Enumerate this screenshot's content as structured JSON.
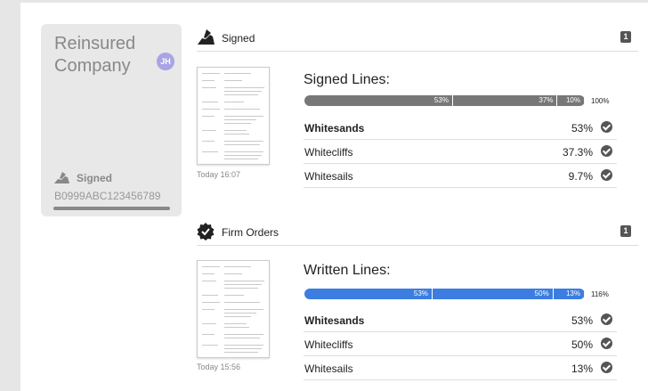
{
  "card": {
    "title": "Reinsured Company",
    "avatar_initials": "JH",
    "status": "Signed",
    "reference": "B0999ABC123456789"
  },
  "sections": [
    {
      "title": "Signed",
      "icon": "signing-hand-icon",
      "count": "1",
      "timestamp": "Today 16:07",
      "lines_title": "Signed Lines:",
      "bar_color": "#777777",
      "bar_segments": [
        {
          "label": "53%",
          "value": 53
        },
        {
          "label": "37%",
          "value": 37.3
        },
        {
          "label": "10%",
          "value": 9.7
        }
      ],
      "bar_total": "100%",
      "rows": [
        {
          "name": "Whitesands",
          "pct": "53%"
        },
        {
          "name": "Whitecliffs",
          "pct": "37.3%"
        },
        {
          "name": "Whitesails",
          "pct": "9.7%"
        }
      ]
    },
    {
      "title": "Firm Orders",
      "icon": "badge-check-icon",
      "count": "1",
      "timestamp": "Today 15:56",
      "lines_title": "Written Lines:",
      "bar_color": "#3b7de0",
      "bar_segments": [
        {
          "label": "53%",
          "value": 53
        },
        {
          "label": "50%",
          "value": 50
        },
        {
          "label": "13%",
          "value": 13
        }
      ],
      "bar_total": "116%",
      "rows": [
        {
          "name": "Whitesands",
          "pct": "53%"
        },
        {
          "name": "Whitecliffs",
          "pct": "50%"
        },
        {
          "name": "Whitesails",
          "pct": "13%"
        }
      ]
    }
  ]
}
